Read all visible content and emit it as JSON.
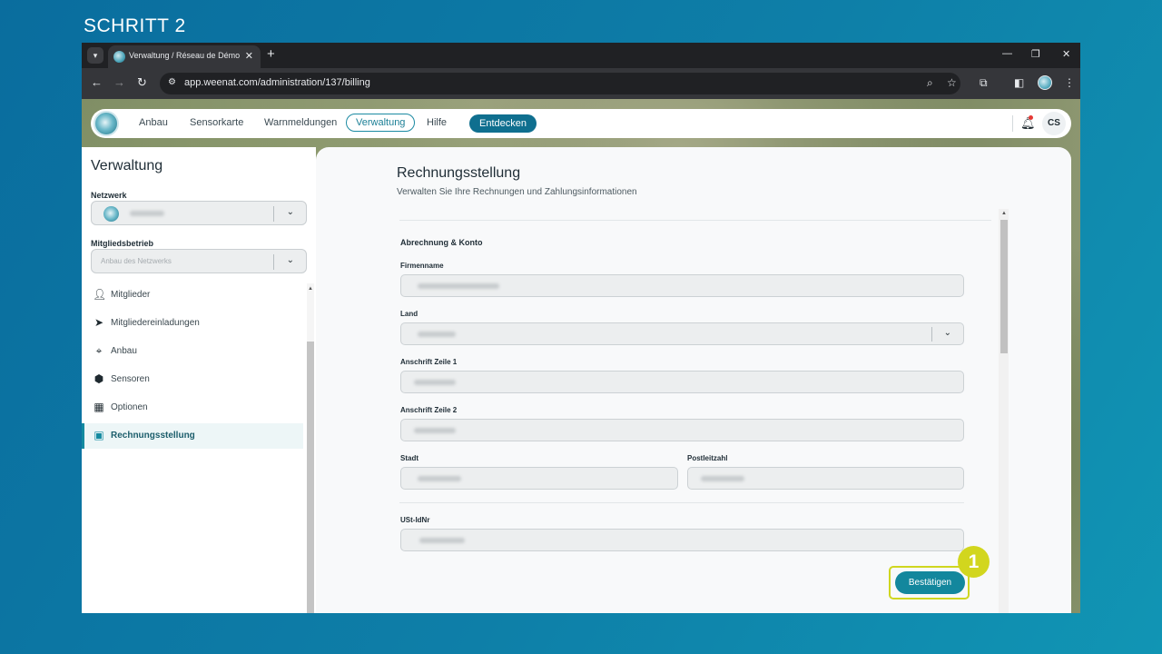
{
  "step_label": "SCHRITT 2",
  "step_number": "1",
  "browser": {
    "tab_title": "Verwaltung / Réseau de Démo",
    "tab_close": "✕",
    "new_tab": "+",
    "url": "app.weenat.com/administration/137/billing",
    "window_controls": {
      "minimize": "—",
      "restore": "❐",
      "close": "✕"
    },
    "icons": [
      "back-icon",
      "forward-icon",
      "reload-icon",
      "site-info-icon",
      "zoom-icon",
      "bookmark-star-icon",
      "extensions-icon",
      "side-panel-icon",
      "profile-icon",
      "kebab-menu-icon"
    ]
  },
  "topnav": {
    "links": [
      {
        "label": "Anbau"
      },
      {
        "label": "Sensorkarte"
      },
      {
        "label": "Warnmeldungen"
      },
      {
        "label": "Verwaltung",
        "active": true
      },
      {
        "label": "Hilfe"
      }
    ],
    "discover_label": "Entdecken",
    "user_initials": "CS"
  },
  "sidebar": {
    "title": "Verwaltung",
    "network_label": "Netzwerk",
    "member_company_label": "Mitgliedsbetrieb",
    "member_company_placeholder": "Anbau des Netzwerks",
    "menu": [
      {
        "label": "Mitglieder",
        "icon": "person-icon"
      },
      {
        "label": "Mitgliedereinladungen",
        "icon": "send-icon"
      },
      {
        "label": "Anbau",
        "icon": "map-pin-icon"
      },
      {
        "label": "Sensoren",
        "icon": "sensor-icon"
      },
      {
        "label": "Optionen",
        "icon": "grid-icon"
      },
      {
        "label": "Rechnungsstellung",
        "icon": "billing-icon",
        "active": true
      }
    ]
  },
  "billing": {
    "title": "Rechnungsstellung",
    "subtitle": "Verwalten Sie Ihre Rechnungen und Zahlungsinformationen",
    "section_title": "Abrechnung & Konto",
    "fields": {
      "company_name": "Firmenname",
      "country": "Land",
      "address_line_1": "Anschrift Zeile 1",
      "address_line_2": "Anschrift Zeile 2",
      "city": "Stadt",
      "postal_code": "Postleitzahl",
      "vat_id": "USt-IdNr"
    },
    "confirm_label": "Bestätigen"
  },
  "colors": {
    "accent": "#13879d",
    "nav_discover": "#0f6f8f",
    "highlight": "#d2d61e",
    "background": "#0e7fa8"
  }
}
